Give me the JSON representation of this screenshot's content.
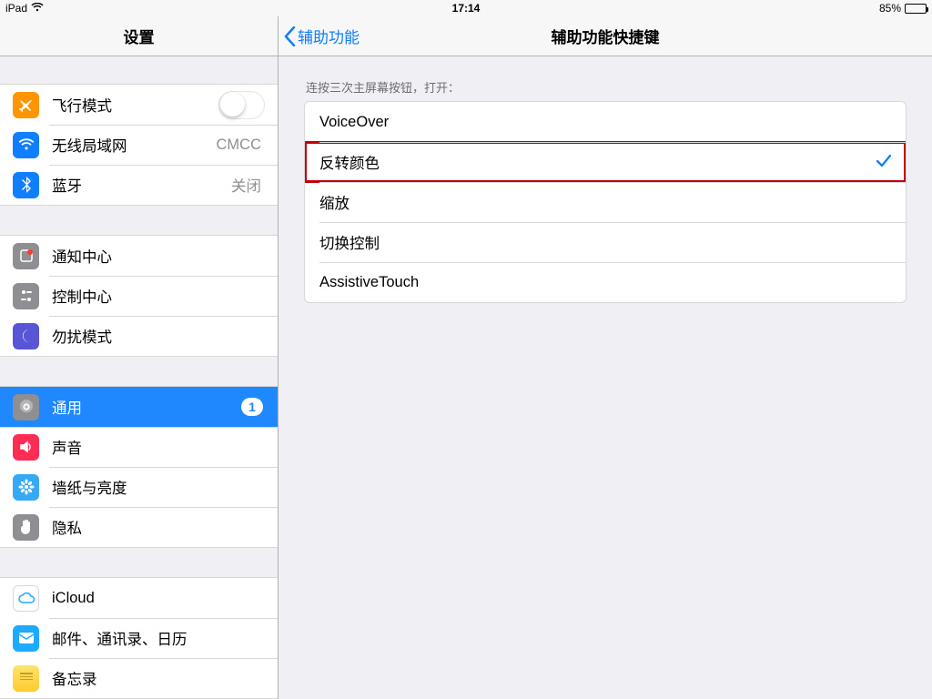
{
  "status": {
    "device": "iPad",
    "time": "17:14",
    "battery_text": "85%"
  },
  "sidebar": {
    "title": "设置",
    "groups": [
      {
        "rows": [
          {
            "id": "airplane",
            "label": "飞行模式",
            "icon_bg": "#ff9500",
            "type": "toggle"
          },
          {
            "id": "wifi",
            "label": "无线局域网",
            "icon_bg": "#0f7eff",
            "value": "CMCC"
          },
          {
            "id": "bluetooth",
            "label": "蓝牙",
            "icon_bg": "#0f7eff",
            "value": "关闭"
          }
        ]
      },
      {
        "rows": [
          {
            "id": "notification",
            "label": "通知中心",
            "icon_bg": "#8e8e93"
          },
          {
            "id": "control",
            "label": "控制中心",
            "icon_bg": "#8e8e93"
          },
          {
            "id": "dnd",
            "label": "勿扰模式",
            "icon_bg": "#5856d6"
          }
        ]
      },
      {
        "rows": [
          {
            "id": "general",
            "label": "通用",
            "icon_bg": "#8e8e93",
            "selected": true,
            "badge": "1"
          },
          {
            "id": "sounds",
            "label": "声音",
            "icon_bg": "#ff2d55"
          },
          {
            "id": "wallpaper",
            "label": "墙纸与亮度",
            "icon_bg": "#36a8f4"
          },
          {
            "id": "privacy",
            "label": "隐私",
            "icon_bg": "#8e8e93"
          }
        ]
      },
      {
        "rows": [
          {
            "id": "icloud",
            "label": "iCloud",
            "icon_bg": "#ffffff",
            "icon_stroke": true
          },
          {
            "id": "mail",
            "label": "邮件、通讯录、日历",
            "icon_bg": "#1cabff"
          },
          {
            "id": "notes",
            "label": "备忘录",
            "icon_bg": "#ffd23f"
          }
        ]
      }
    ]
  },
  "detail": {
    "back_label": "辅助功能",
    "title": "辅助功能快捷键",
    "section_header": "连按三次主屏幕按钮，打开：",
    "options": [
      {
        "label": "VoiceOver",
        "checked": false,
        "highlight": false
      },
      {
        "label": "反转颜色",
        "checked": true,
        "highlight": true
      },
      {
        "label": "缩放",
        "checked": false,
        "highlight": false
      },
      {
        "label": "切换控制",
        "checked": false,
        "highlight": false
      },
      {
        "label": "AssistiveTouch",
        "checked": false,
        "highlight": false
      }
    ]
  },
  "icons": {
    "airplane": "airplane-icon",
    "wifi": "wifi-icon",
    "bluetooth": "bluetooth-icon",
    "notification": "notification-icon",
    "control": "control-center-icon",
    "dnd": "moon-icon",
    "general": "gear-icon",
    "sounds": "speaker-icon",
    "wallpaper": "flower-icon",
    "privacy": "hand-icon",
    "icloud": "cloud-icon",
    "mail": "mail-icon",
    "notes": "notes-icon"
  }
}
